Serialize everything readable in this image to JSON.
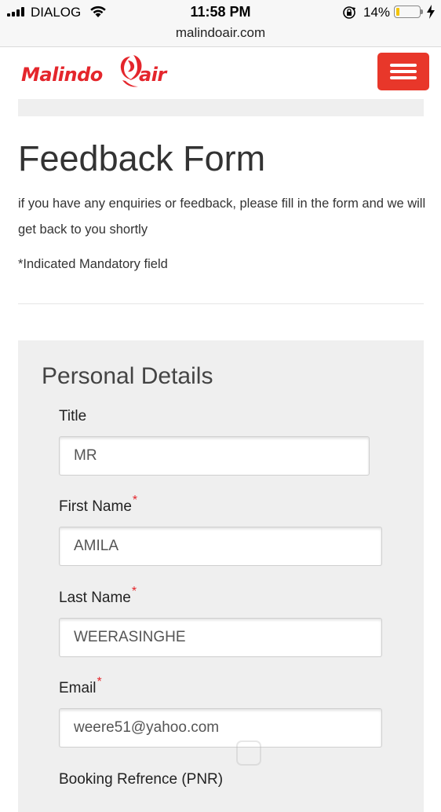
{
  "status_bar": {
    "carrier": "DIALOG",
    "time": "11:58 PM",
    "battery_percent": "14%",
    "battery_level": 0.14,
    "battery_color": "#f4c400"
  },
  "browser": {
    "url": "malindoair.com"
  },
  "header": {
    "logo_left": "Malindo",
    "logo_right": "air",
    "brand_color": "#e4262c",
    "menu_button_color": "#e8372a"
  },
  "page": {
    "title": "Feedback Form",
    "intro": "if you have any enquiries or feedback, please fill in the form and we will get back to you shortly",
    "mandatory_note": "*Indicated Mandatory field"
  },
  "personal_details": {
    "section_title": "Personal Details",
    "fields": {
      "title": {
        "label": "Title",
        "value": "MR"
      },
      "first_name": {
        "label": "First Name",
        "value": "AMILA",
        "required": "*"
      },
      "last_name": {
        "label": "Last Name",
        "value": "WEERASINGHE",
        "required": "*"
      },
      "email": {
        "label": "Email",
        "value": "weere51@yahoo.com",
        "required": "*"
      },
      "booking_ref": {
        "label": "Booking Refrence (PNR)"
      }
    }
  }
}
